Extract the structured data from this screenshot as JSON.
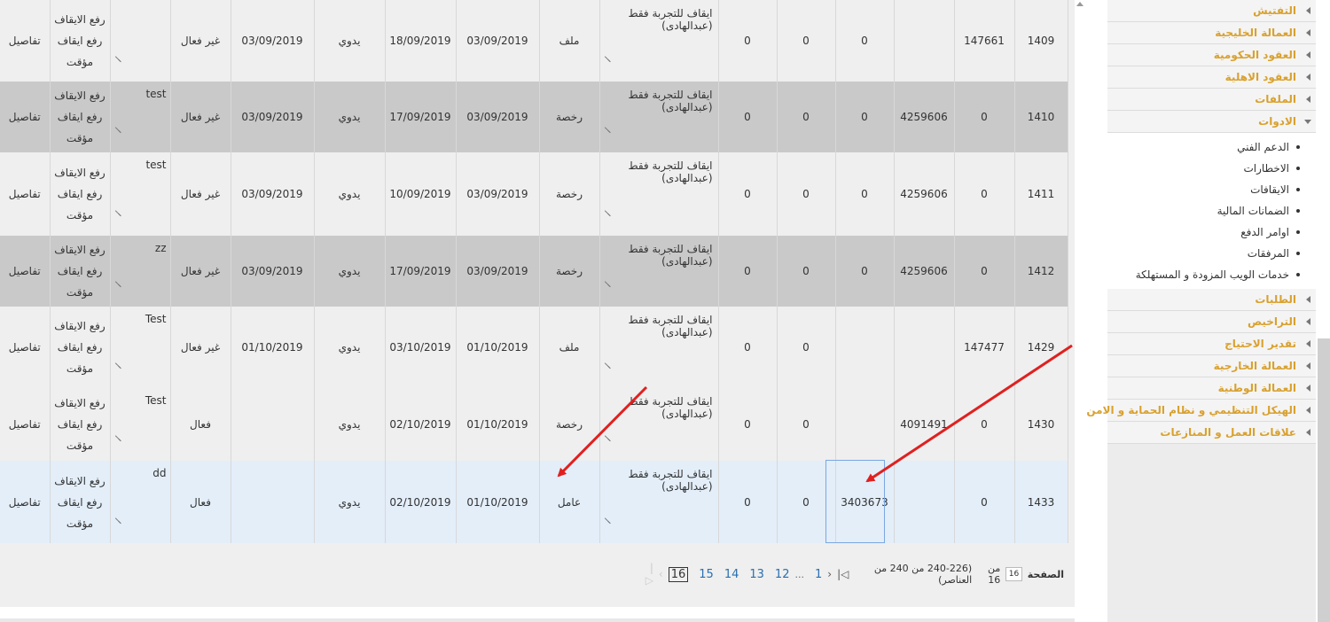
{
  "table": {
    "rows": [
      {
        "details": "تفاصيل",
        "actions": [
          "رفع الايقاف",
          "رفع ايقاف",
          "مؤقت"
        ],
        "note": "",
        "status": "غير فعال",
        "date3": "03/09/2019",
        "method": "يدوي",
        "date2": "18/09/2019",
        "date1": "03/09/2019",
        "type": "ملف",
        "desc": "ايقاف للتجربة فقط (عبدالهادى)",
        "v1": "0",
        "v2": "0",
        "v3": "0",
        "ref1": "",
        "ref2": "147661",
        "id": "1409"
      },
      {
        "details": "تفاصيل",
        "actions": [
          "رفع الايقاف",
          "رفع ايقاف",
          "مؤقت"
        ],
        "note": "test",
        "status": "غير فعال",
        "date3": "03/09/2019",
        "method": "يدوي",
        "date2": "17/09/2019",
        "date1": "03/09/2019",
        "type": "رخصة",
        "desc": "ايقاف للتجربة فقط (عبدالهادى)",
        "v1": "0",
        "v2": "0",
        "v3": "0",
        "ref1": "4259606",
        "ref2": "0",
        "id": "1410"
      },
      {
        "details": "تفاصيل",
        "actions": [
          "رفع الايقاف",
          "رفع ايقاف",
          "مؤقت"
        ],
        "note": "test",
        "status": "غير فعال",
        "date3": "03/09/2019",
        "method": "يدوي",
        "date2": "10/09/2019",
        "date1": "03/09/2019",
        "type": "رخصة",
        "desc": "ايقاف للتجربة فقط (عبدالهادى)",
        "v1": "0",
        "v2": "0",
        "v3": "0",
        "ref1": "4259606",
        "ref2": "0",
        "id": "1411"
      },
      {
        "details": "تفاصيل",
        "actions": [
          "رفع الايقاف",
          "رفع ايقاف",
          "مؤقت"
        ],
        "note": "zz",
        "status": "غير فعال",
        "date3": "03/09/2019",
        "method": "يدوي",
        "date2": "17/09/2019",
        "date1": "03/09/2019",
        "type": "رخصة",
        "desc": "ايقاف للتجربة فقط (عبدالهادى)",
        "v1": "0",
        "v2": "0",
        "v3": "0",
        "ref1": "4259606",
        "ref2": "0",
        "id": "1412"
      },
      {
        "details": "تفاصيل",
        "actions": [
          "رفع الايقاف",
          "رفع ايقاف",
          "مؤقت"
        ],
        "note": "Test",
        "status": "غير فعال",
        "date3": "01/10/2019",
        "method": "يدوي",
        "date2": "03/10/2019",
        "date1": "01/10/2019",
        "type": "ملف",
        "desc": "ايقاف للتجربة فقط (عبدالهادى)",
        "v1": "0",
        "v2": "0",
        "v3": "",
        "ref1": "",
        "ref2": "147477",
        "id": "1429"
      },
      {
        "details": "تفاصيل",
        "actions": [
          "رفع الايقاف",
          "رفع ايقاف",
          "مؤقت"
        ],
        "note": "Test",
        "status": "فعال",
        "date3": "",
        "method": "يدوي",
        "date2": "02/10/2019",
        "date1": "01/10/2019",
        "type": "رخصة",
        "desc": "ايقاف للتجربة فقط (عبدالهادى)",
        "v1": "0",
        "v2": "0",
        "v3": "",
        "ref1": "4091491",
        "ref2": "0",
        "id": "1430"
      },
      {
        "details": "تفاصيل",
        "actions": [
          "رفع الايقاف",
          "رفع ايقاف",
          "مؤقت"
        ],
        "note": "dd",
        "status": "فعال",
        "date3": "",
        "method": "يدوي",
        "date2": "02/10/2019",
        "date1": "01/10/2019",
        "type": "عامل",
        "desc": "ايقاف للتجربة فقط (عبدالهادى)",
        "v1": "0",
        "v2": "0",
        "v3": "3403673",
        "ref1": "",
        "ref2": "0",
        "id": "1433"
      }
    ]
  },
  "pager": {
    "label": "الصفحة",
    "current": "16",
    "of_label": "من 16",
    "range": "(240-226 من 240 من العناصر)",
    "pages": [
      "1",
      "12",
      "13",
      "14",
      "15"
    ],
    "ellipsis": "...",
    "current_page": "16"
  },
  "sidebar": {
    "items_top": [
      "التفتيش",
      "العمالة الخليجية",
      "العقود الحكومية",
      "العقود الاهلية",
      "الملفات"
    ],
    "open_item": "الادوات",
    "sub_items": [
      "الدعم الفني",
      "الاخطارات",
      "الايقافات",
      "الضمانات المالية",
      "اوامر الدفع",
      "المرفقات",
      "خدمات الويب المزودة و المستهلكة"
    ],
    "items_bottom": [
      "الطلبات",
      "التراخيص",
      "تقدير الاحتياج",
      "العمالة الخارجية",
      "العمالة الوطنية",
      "الهيكل التنظيمي و نظام الحماية و الامن",
      "علاقات العمل و المنازعات"
    ]
  },
  "colors": {
    "accent": "#d9a12e",
    "arrow": "#e02020",
    "highlight": "#7aa7e0",
    "link": "#2a6fb0"
  }
}
